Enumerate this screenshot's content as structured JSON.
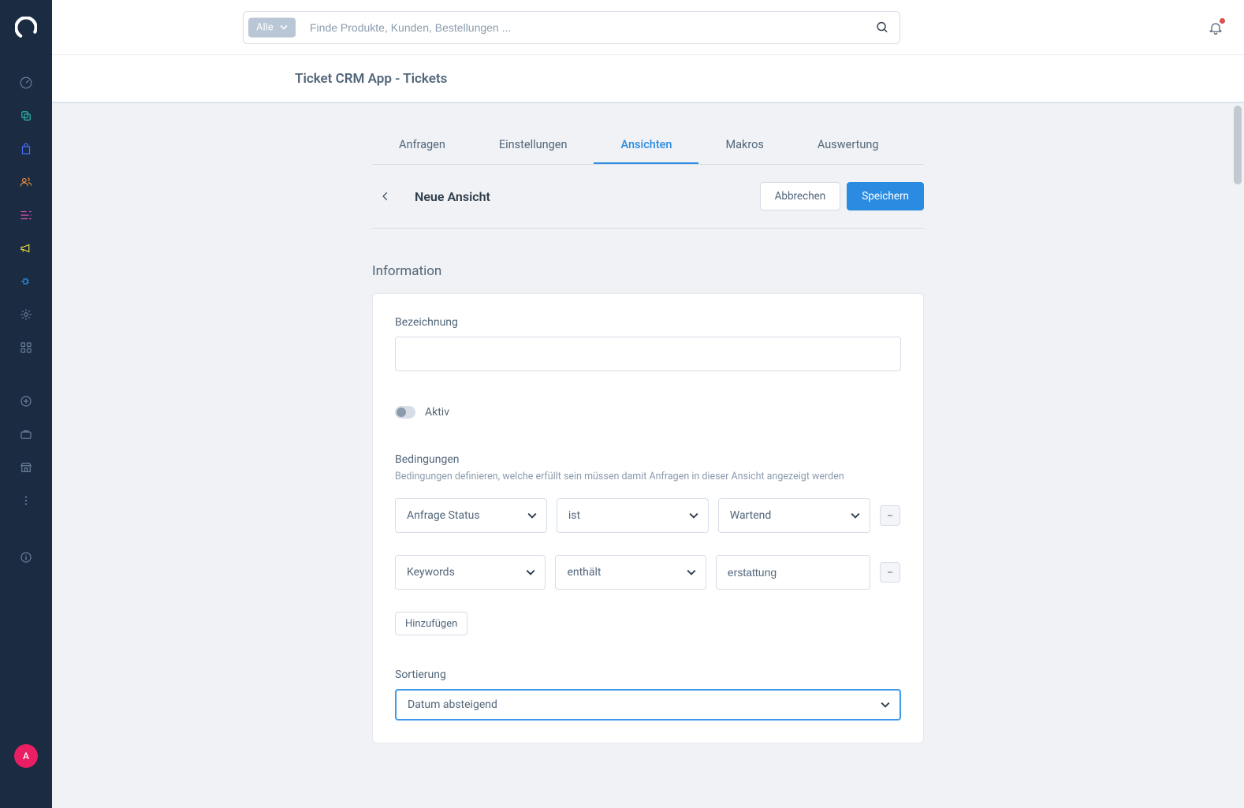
{
  "search": {
    "scope": "Alle",
    "placeholder": "Finde Produkte, Kunden, Bestellungen ..."
  },
  "page_title": "Ticket CRM App - Tickets",
  "tabs": [
    {
      "label": "Anfragen"
    },
    {
      "label": "Einstellungen"
    },
    {
      "label": "Ansichten"
    },
    {
      "label": "Makros"
    },
    {
      "label": "Auswertung"
    }
  ],
  "action_title": "Neue Ansicht",
  "buttons": {
    "cancel": "Abbrechen",
    "save": "Speichern",
    "add": "Hinzufügen"
  },
  "section": {
    "title": "Information",
    "label_name": "Bezeichnung",
    "toggle_label": "Aktiv",
    "conditions_label": "Bedingungen",
    "conditions_desc": "Bedingungen definieren, welche erfüllt sein müssen damit Anfragen in dieser Ansicht angezeigt werden",
    "conditions": [
      {
        "field": "Anfrage Status",
        "op": "ist",
        "value": "Wartend",
        "value_type": "select"
      },
      {
        "field": "Keywords",
        "op": "enthält",
        "value": "erstattung",
        "value_type": "text"
      }
    ],
    "sort_label": "Sortierung",
    "sort_value": "Datum absteigend"
  },
  "avatar_letter": "A"
}
